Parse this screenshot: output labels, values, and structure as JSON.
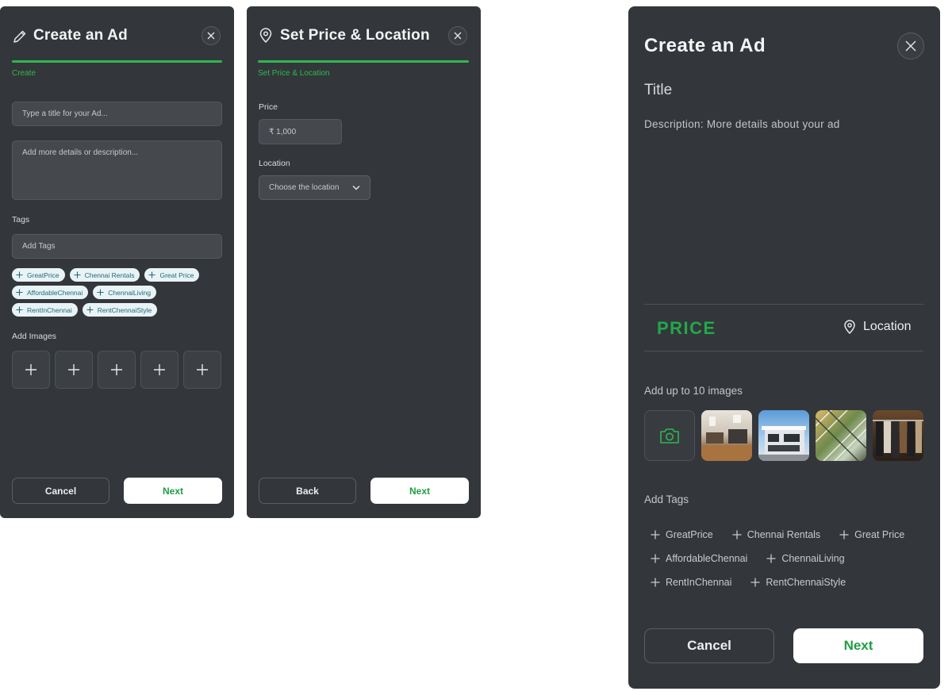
{
  "panel1": {
    "title": "Create an Ad",
    "step": "Create",
    "title_placeholder": "Type a title for your Ad...",
    "description_placeholder": "Add more details or description...",
    "tags_label": "Tags",
    "tags_placeholder": "Add Tags",
    "tags": [
      "GreatPrice",
      "Chennai Rentals",
      "Great Price",
      "AffordableChennai",
      "ChennaiLiving",
      "RentInChennai",
      "RentChennaiStyle"
    ],
    "images_label": "Add Images",
    "cancel": "Cancel",
    "next": "Next"
  },
  "panel2": {
    "title": "Set Price & Location",
    "step": "Set Price & Location",
    "price_label": "Price",
    "price_value": "₹ 1,000",
    "location_label": "Location",
    "location_value": "Choose the location",
    "back": "Back",
    "next": "Next"
  },
  "panel3": {
    "title": "Create an Ad",
    "field_title": "Title",
    "description": "Description: More details about your ad",
    "price": "PRICE",
    "location": "Location",
    "images_label": "Add up to 10 images",
    "tags_label": "Add Tags",
    "tags": [
      "GreatPrice",
      "Chennai Rentals",
      "Great Price",
      "AffordableChennai",
      "ChennaiLiving",
      "RentInChennai",
      "RentChennaiStyle"
    ],
    "cancel": "Cancel",
    "next": "Next"
  },
  "colors": {
    "panel": "#33373b",
    "accent": "#2eb84f",
    "chip_bg": "#e9f3f6"
  },
  "icons": [
    "pencil-icon",
    "location-pin-icon",
    "close-icon",
    "plus-icon",
    "chevron-down-icon",
    "camera-icon"
  ]
}
